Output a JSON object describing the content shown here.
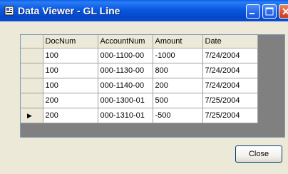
{
  "window": {
    "title": "Data Viewer - GL Line"
  },
  "grid": {
    "columns": [
      "DocNum",
      "AccountNum",
      "Amount",
      "Date"
    ],
    "rows": [
      {
        "DocNum": "100",
        "AccountNum": "000-1100-00",
        "Amount": "-1000",
        "Date": "7/24/2004",
        "current": false
      },
      {
        "DocNum": "100",
        "AccountNum": "000-1130-00",
        "Amount": "800",
        "Date": "7/24/2004",
        "current": false
      },
      {
        "DocNum": "100",
        "AccountNum": "000-1140-00",
        "Amount": "200",
        "Date": "7/24/2004",
        "current": false
      },
      {
        "DocNum": "200",
        "AccountNum": "000-1300-01",
        "Amount": "500",
        "Date": "7/25/2004",
        "current": false
      },
      {
        "DocNum": "200",
        "AccountNum": "000-1310-01",
        "Amount": "-500",
        "Date": "7/25/2004",
        "current": true
      }
    ]
  },
  "buttons": {
    "close_label": "Close"
  },
  "icons": {
    "app": "data-viewer-app-icon",
    "minimize": "minimize-icon",
    "maximize": "maximize-icon",
    "close": "close-icon",
    "current_row": "current-row-arrow-icon"
  },
  "colors": {
    "titlebar": "#0a58e0",
    "window_bg": "#ece9d8",
    "grid_bg": "#808080",
    "close_caption": "#e0583a"
  }
}
